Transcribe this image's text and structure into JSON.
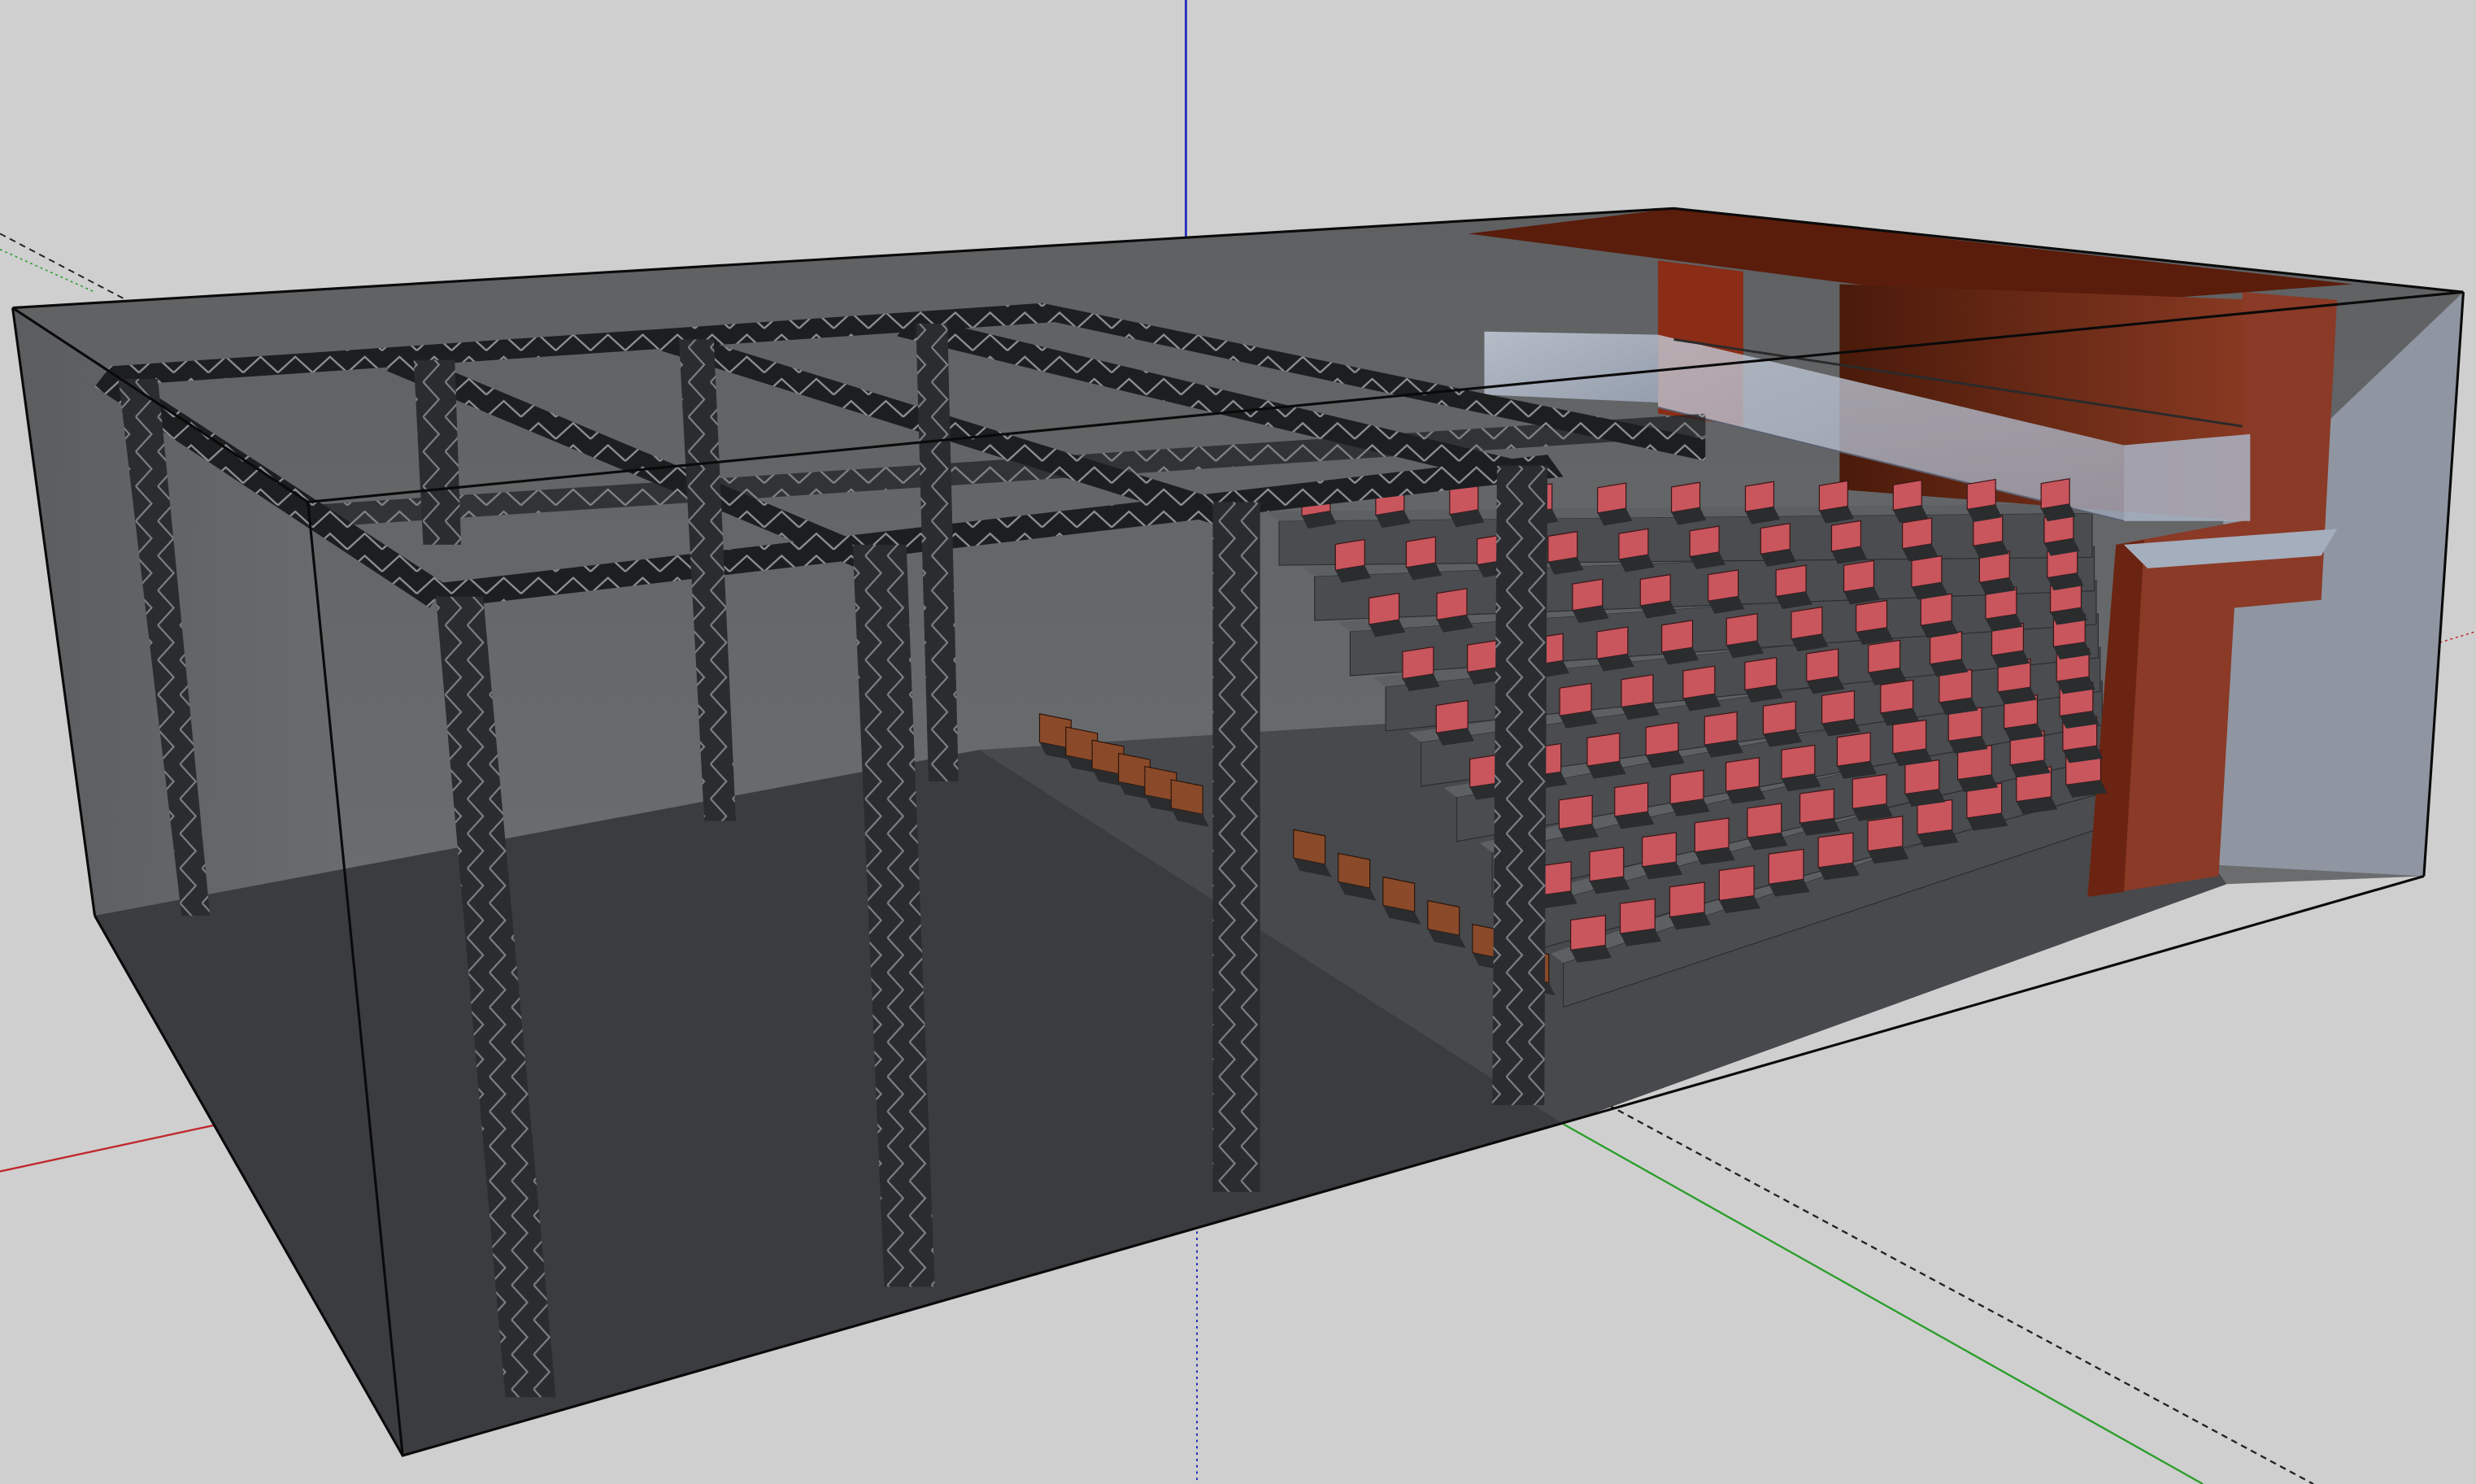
{
  "app": {
    "viewport_label": ""
  },
  "scene": {
    "background_color": "#cfcfcf",
    "axis_colors": {
      "x": "#c0272d",
      "y": "#2a9d2a",
      "z": "#1f2ab8"
    },
    "box_wall_color": "#6f7275",
    "box_floor_color": "#383a3d",
    "truss_color": "#1e2022",
    "seat_color": "#b94a52",
    "seat_back_color": "#c9555d",
    "bench_seat_color": "#8a4a2a",
    "riser_color": "#4a4c4f",
    "booth_color": "#7a2a14",
    "booth_dark_color": "#3a1408",
    "glass_color": "#b9c3d3",
    "edge_color": "#0a0a0a",
    "objects": [
      {
        "name": "room-box"
      },
      {
        "name": "roof-truss-grid"
      },
      {
        "name": "truss-columns",
        "count": 8
      },
      {
        "name": "seating-risers"
      },
      {
        "name": "audience-seats",
        "rows": 9
      },
      {
        "name": "front-bench-seats",
        "rows": 2
      },
      {
        "name": "control-booth"
      },
      {
        "name": "glass-balcony"
      }
    ]
  }
}
